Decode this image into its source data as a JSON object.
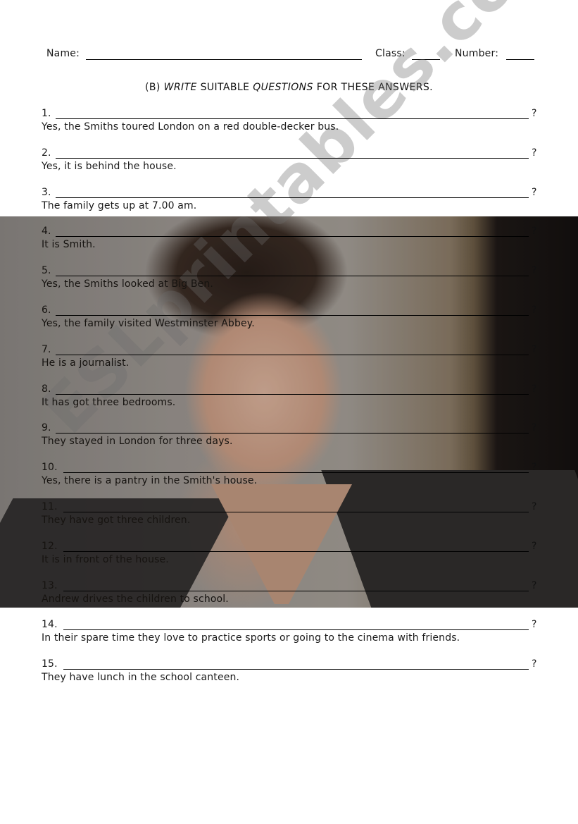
{
  "header": {
    "name_label": "Name:",
    "class_label": "Class:",
    "number_label": "Number:"
  },
  "title": {
    "prefix": "(B) ",
    "write": "WRITE",
    "middle": " SUITABLE ",
    "questions": "QUESTIONS",
    "suffix": " FOR THESE ANSWERS."
  },
  "question_mark": "?",
  "watermark": "ESLprintables.com",
  "items": [
    {
      "num": "1.",
      "answer": "Yes, the Smiths toured London on a red double-decker bus."
    },
    {
      "num": "2.",
      "answer": "Yes, it is behind the house."
    },
    {
      "num": "3.",
      "answer": "The family gets up at 7.00 am."
    },
    {
      "num": "4.",
      "answer": "It is Smith."
    },
    {
      "num": "5.",
      "answer": "Yes, the Smiths looked at Big Ben."
    },
    {
      "num": "6.",
      "answer": "Yes, the family visited Westminster Abbey."
    },
    {
      "num": "7.",
      "answer": "He is a journalist."
    },
    {
      "num": "8.",
      "answer": "It has got three bedrooms."
    },
    {
      "num": "9.",
      "answer": "They stayed in London for three days."
    },
    {
      "num": "10.",
      "answer": "Yes, there is a pantry in the Smith's house."
    },
    {
      "num": "11.",
      "answer": "They have got three children."
    },
    {
      "num": "12.",
      "answer": "It is in front of the house."
    },
    {
      "num": "13.",
      "answer": "Andrew drives the children to school."
    },
    {
      "num": "14.",
      "answer": "In their spare time they love to practice sports or going to the cinema with friends."
    },
    {
      "num": "15.",
      "answer": "They have lunch in the school canteen."
    }
  ]
}
